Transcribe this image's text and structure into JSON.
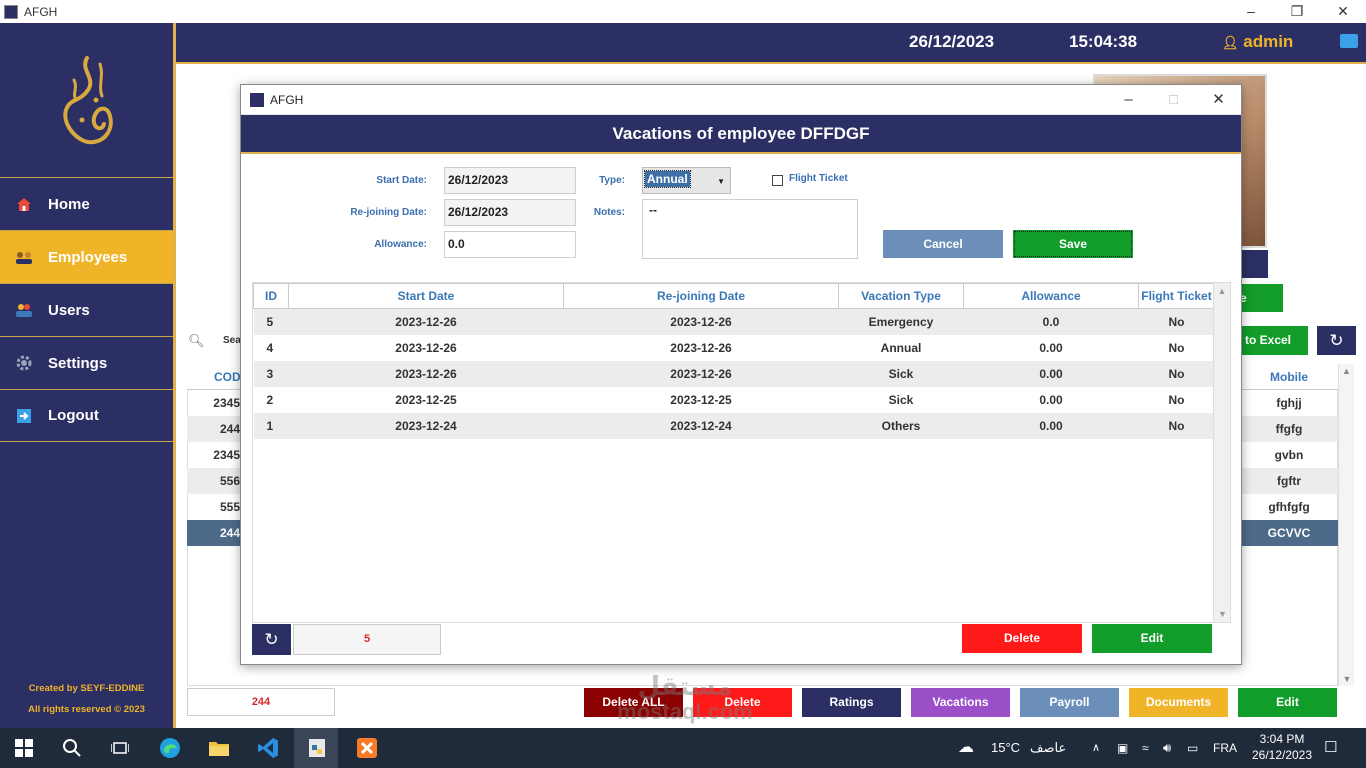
{
  "window": {
    "title": "AFGH"
  },
  "sidebar": {
    "items": [
      {
        "label": "Home",
        "icon": "home-icon"
      },
      {
        "label": "Employees",
        "icon": "employees-icon"
      },
      {
        "label": "Users",
        "icon": "users-icon"
      },
      {
        "label": "Settings",
        "icon": "gear-icon"
      },
      {
        "label": "Logout",
        "icon": "logout-icon"
      }
    ],
    "footer_line1": "Created by SEYF-EDDINE",
    "footer_line2": "All rights reserved © 2023"
  },
  "header": {
    "date": "26/12/2023",
    "time": "15:04:38",
    "user": "admin"
  },
  "main": {
    "search_label": "Sear",
    "export_label": "to Excel",
    "green_label": "e",
    "left_column": {
      "header": "COD",
      "values": [
        "2345",
        "244",
        "2345",
        "556",
        "555",
        "244"
      ]
    },
    "right_column": {
      "header": "Mobile",
      "values": [
        "fghjj",
        "ffgfg",
        "gvbn",
        "fgftr",
        "gfhfgfg",
        "GCVVC"
      ]
    },
    "bottom_count": "244",
    "buttons": {
      "delete_all": "Delete ALL",
      "delete": "Delete",
      "ratings": "Ratings",
      "vacations": "Vacations",
      "payroll": "Payroll",
      "documents": "Documents",
      "edit": "Edit"
    }
  },
  "dialog": {
    "title": "AFGH",
    "header": "Vacations of employee DFFDGF",
    "form": {
      "start_date_label": "Start Date:",
      "start_date": "26/12/2023",
      "rejoin_label": "Re-joining Date:",
      "rejoin_date": "26/12/2023",
      "allowance_label": "Allowance:",
      "allowance": "0.0",
      "type_label": "Type:",
      "type_value": "Annual",
      "notes_label": "Notes:",
      "notes_value": "--",
      "flight_ticket_label": "Flight Ticket",
      "cancel": "Cancel",
      "save": "Save"
    },
    "table": {
      "columns": [
        "ID",
        "Start Date",
        "Re-joining Date",
        "Vacation Type",
        "Allowance",
        "Flight Ticket"
      ],
      "rows": [
        [
          "5",
          "2023-12-26",
          "2023-12-26",
          "Emergency",
          "0.0",
          "No"
        ],
        [
          "4",
          "2023-12-26",
          "2023-12-26",
          "Annual",
          "0.00",
          "No"
        ],
        [
          "3",
          "2023-12-26",
          "2023-12-26",
          "Sick",
          "0.00",
          "No"
        ],
        [
          "2",
          "2023-12-25",
          "2023-12-25",
          "Sick",
          "0.00",
          "No"
        ],
        [
          "1",
          "2023-12-24",
          "2023-12-24",
          "Others",
          "0.00",
          "No"
        ]
      ]
    },
    "footer": {
      "count": "5",
      "delete": "Delete",
      "edit": "Edit"
    }
  },
  "taskbar": {
    "temperature": "15°C",
    "weather": "عاصف",
    "language": "FRA",
    "clock_time": "3:04 PM",
    "clock_date": "26/12/2023"
  },
  "watermark": {
    "arabic": "مستقل",
    "latin": "mostaql.com"
  },
  "colors": {
    "navy": "#2b2f63",
    "gold": "#f0b429",
    "green": "#129c2a",
    "red": "#ff1a1a",
    "dark_red": "#8b0000",
    "purple": "#9b4fc8",
    "steel_blue": "#6b8fb8",
    "link_blue": "#3a78b8"
  }
}
